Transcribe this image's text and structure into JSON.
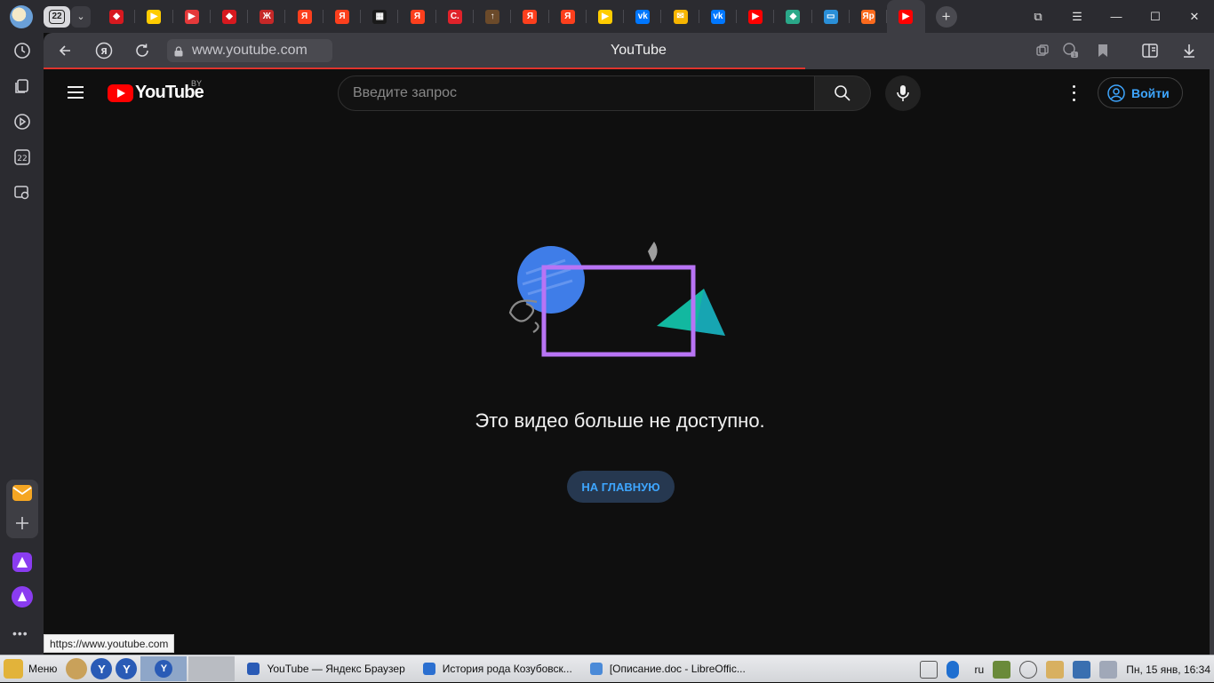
{
  "tabbar": {
    "tab_count": "22",
    "tabs": [
      {
        "icon": "red-diamond-icon",
        "color": "#d7191f",
        "glyph": "◆"
      },
      {
        "icon": "yellow-play-icon",
        "color": "#ffcc00",
        "glyph": "▶"
      },
      {
        "icon": "red-play-icon",
        "color": "#e5393a",
        "glyph": "▶"
      },
      {
        "icon": "red-diamond-icon",
        "color": "#d7191f",
        "glyph": "◆"
      },
      {
        "icon": "red-letter-icon",
        "color": "#c62828",
        "glyph": "Ж"
      },
      {
        "icon": "yandex-icon",
        "color": "#fc3f1d",
        "glyph": "Я"
      },
      {
        "icon": "yandex-icon",
        "color": "#fc3f1d",
        "glyph": "Я"
      },
      {
        "icon": "grid-logo-icon",
        "color": "#1a1a1a",
        "glyph": "▦"
      },
      {
        "icon": "yandex-icon",
        "color": "#fc3f1d",
        "glyph": "Я"
      },
      {
        "icon": "c-logo-icon",
        "color": "#e0222a",
        "glyph": "C."
      },
      {
        "icon": "brown-arrow-icon",
        "color": "#6b4a2a",
        "glyph": "↑"
      },
      {
        "icon": "yandex-icon",
        "color": "#fc3f1d",
        "glyph": "Я"
      },
      {
        "icon": "yandex-icon",
        "color": "#fc3f1d",
        "glyph": "Я"
      },
      {
        "icon": "yellow-play-icon",
        "color": "#ffcc00",
        "glyph": "▶"
      },
      {
        "icon": "vk-icon",
        "color": "#0077ff",
        "glyph": "vk"
      },
      {
        "icon": "mail-icon",
        "color": "#f7b500",
        "glyph": "✉"
      },
      {
        "icon": "vk-icon",
        "color": "#0077ff",
        "glyph": "vk"
      },
      {
        "icon": "youtube-icon",
        "color": "#ff0000",
        "glyph": "▶"
      },
      {
        "icon": "teal-diamond-icon",
        "color": "#2aa889",
        "glyph": "◆"
      },
      {
        "icon": "keyboard-icon",
        "color": "#2a8fd8",
        "glyph": "▭"
      },
      {
        "icon": "yandex-music-icon",
        "color": "#fc6a1d",
        "glyph": "Яр"
      },
      {
        "icon": "youtube-icon",
        "color": "#ff0000",
        "glyph": "▶",
        "active": true
      }
    ]
  },
  "address": {
    "url": "www.youtube.com",
    "title": "YouTube"
  },
  "youtube": {
    "region": "BY",
    "logo_text": "YouTube",
    "search_placeholder": "Введите запрос",
    "signin_label": "Войти",
    "error_message": "Это видео больше не доступно.",
    "home_button": "НА ГЛАВНУЮ"
  },
  "status_url": "https://www.youtube.com",
  "taskbar": {
    "menu_label": "Меню",
    "tasks": [
      {
        "label": "YouTube — Яндекс Браузер",
        "color": "#2a5bb6"
      },
      {
        "label": "История рода Козубовск...",
        "color": "#2b6fd0"
      },
      {
        "label": "[Описание.doc - LibreOffic...",
        "color": "#4a8ad8"
      }
    ],
    "lang": "ru",
    "datetime": "Пн, 15 янв, 16:34"
  },
  "colors": {
    "yt_red": "#ff0000",
    "link_blue": "#3ea6ff",
    "load_bar": "#e0332d"
  }
}
